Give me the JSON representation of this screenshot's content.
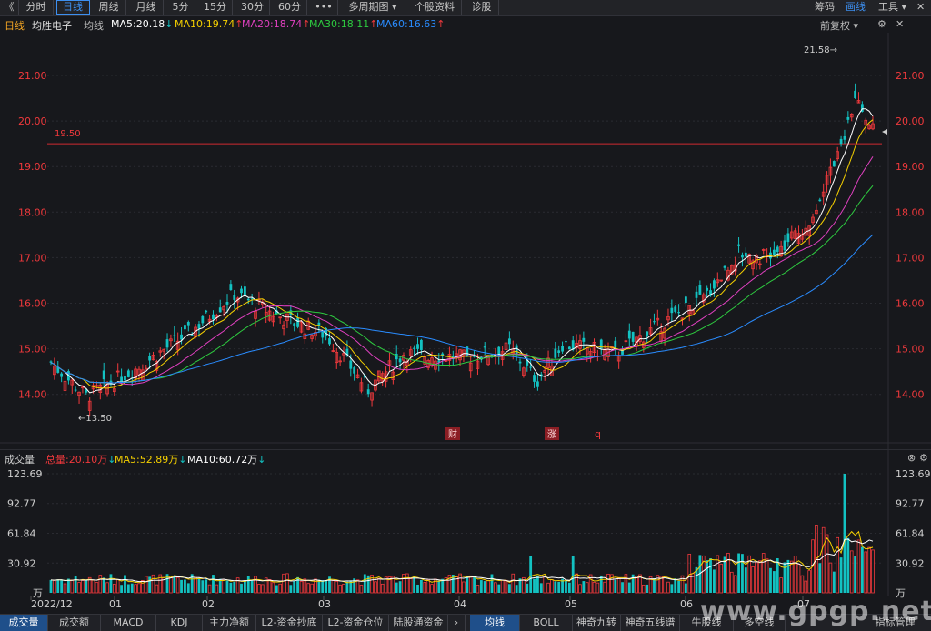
{
  "toolbar": {
    "back_glyph": "《",
    "tabs": [
      {
        "label": "分时",
        "active": false
      },
      {
        "label": "日线",
        "active": true
      },
      {
        "label": "周线",
        "active": false
      },
      {
        "label": "月线",
        "active": false
      },
      {
        "label": "5分",
        "active": false
      },
      {
        "label": "15分",
        "active": false
      },
      {
        "label": "30分",
        "active": false
      },
      {
        "label": "60分",
        "active": false
      },
      {
        "label": "•••",
        "active": false
      },
      {
        "label": "多周期图 ▾",
        "active": false
      },
      {
        "label": "个股资料",
        "active": false
      },
      {
        "label": "诊股",
        "active": false
      }
    ],
    "right": {
      "chips": "筹码",
      "draw": "画线",
      "tools": "工具 ▾",
      "close": "✕"
    }
  },
  "info_bar": {
    "period": "日线",
    "stock_name": "均胜电子",
    "ma_label": "均线",
    "ma5": "MA5:20.18",
    "ma10": "MA10:19.74",
    "ma20": "MA20:18.74",
    "ma30": "MA30:18.11",
    "ma60": "MA60:16.63",
    "ma5_arrow": "↓",
    "ma10_arrow": "↑",
    "ma20_arrow": "↑",
    "ma30_arrow": "↑",
    "ma60_arrow": "↑",
    "adjust": "前复权 ▾",
    "close": "✕",
    "colors": {
      "ma5": "#ffffff",
      "ma10": "#f5d000",
      "ma20": "#e040c0",
      "ma30": "#2ecc40",
      "ma60": "#2a8cff",
      "up": "#f0393c",
      "down": "#13c2c2"
    }
  },
  "price_chart": {
    "y_ticks": [
      "21.00",
      "20.00",
      "19.00",
      "18.00",
      "17.00",
      "16.00",
      "15.00",
      "14.00"
    ],
    "y_tick_values": [
      21,
      20,
      19,
      18,
      17,
      16,
      15,
      14
    ],
    "hline_label": "19.50",
    "hline_value": 19.5,
    "high_label": "21.58→",
    "low_label": "←13.50",
    "markers": [
      "财",
      "涨",
      "q"
    ]
  },
  "volume_bar": {
    "title": "成交量",
    "total": "总量:20.10万",
    "total_arrow": "↓",
    "ma5": "MA5:52.89万",
    "ma5_arrow": "↓",
    "ma10": "MA10:60.72万",
    "ma10_arrow": "↓",
    "y_ticks": [
      "123.69",
      "92.77",
      "61.84",
      "30.92",
      "万"
    ],
    "y_tick_values": [
      123.69,
      92.77,
      61.84,
      30.92,
      0
    ]
  },
  "x_axis": [
    "2022/12",
    "01",
    "02",
    "03",
    "04",
    "05",
    "06",
    "07"
  ],
  "bottom_tabs": {
    "left": [
      "成交量",
      "成交额",
      "MACD",
      "KDJ",
      "主力净额",
      "L2-资金抄底",
      "L2-资金仓位",
      "陆股通资金",
      "›"
    ],
    "right": [
      "均线",
      "BOLL",
      "神奇九转",
      "神奇五线谱",
      "牛股线",
      "多空线",
      "指标管理"
    ],
    "active_left": "成交量",
    "active_right": "均线"
  },
  "watermark": "www.gpgp.net"
}
